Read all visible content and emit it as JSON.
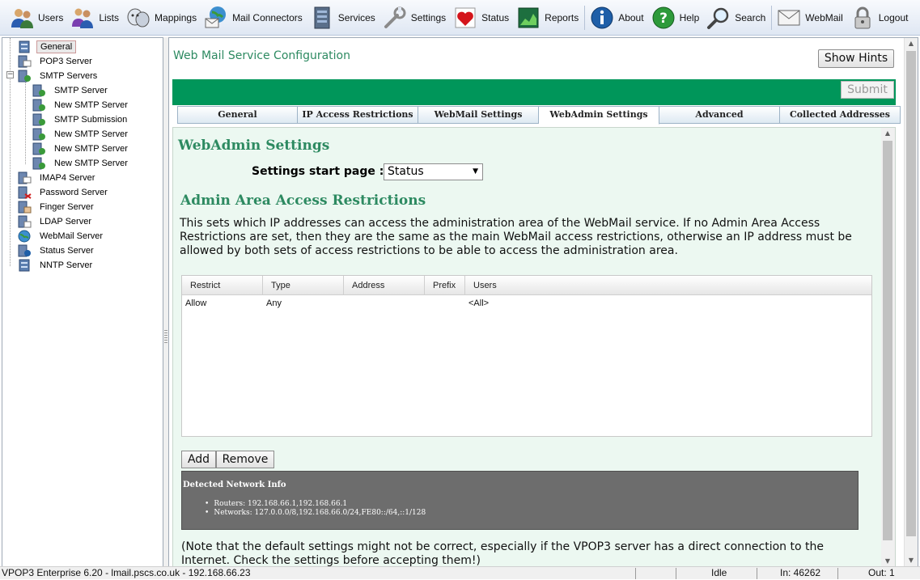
{
  "toolbar": {
    "items": [
      {
        "label": "Users",
        "icon": "users-icon"
      },
      {
        "label": "Lists",
        "icon": "lists-icon"
      },
      {
        "label": "Mappings",
        "icon": "mappings-icon"
      },
      {
        "label": "Mail Connectors",
        "icon": "mail-connectors-icon"
      },
      {
        "label": "Services",
        "icon": "services-icon"
      },
      {
        "label": "Settings",
        "icon": "settings-icon"
      },
      {
        "label": "Status",
        "icon": "status-icon"
      },
      {
        "label": "Reports",
        "icon": "reports-icon"
      },
      {
        "label": "About",
        "icon": "about-icon"
      },
      {
        "label": "Help",
        "icon": "help-icon"
      },
      {
        "label": "Search",
        "icon": "search-icon"
      },
      {
        "label": "WebMail",
        "icon": "webmail-icon"
      },
      {
        "label": "Logout",
        "icon": "logout-icon"
      }
    ]
  },
  "tree": {
    "items": [
      {
        "label": "General",
        "selected": true
      },
      {
        "label": "POP3 Server"
      },
      {
        "label": "SMTP Servers",
        "expanded": true
      },
      {
        "label": "SMTP Server"
      },
      {
        "label": "New SMTP Server"
      },
      {
        "label": "SMTP Submission"
      },
      {
        "label": "New SMTP Server"
      },
      {
        "label": "New SMTP Server"
      },
      {
        "label": "New SMTP Server"
      },
      {
        "label": "IMAP4 Server"
      },
      {
        "label": "Password Server"
      },
      {
        "label": "Finger Server"
      },
      {
        "label": "LDAP Server"
      },
      {
        "label": "WebMail Server"
      },
      {
        "label": "Status Server"
      },
      {
        "label": "NNTP Server"
      }
    ],
    "toggle_symbol": "−"
  },
  "main": {
    "title": "Web Mail Service Configuration",
    "show_hints_label": "Show Hints",
    "submit_label": "Submit",
    "tabs": [
      {
        "label": "General"
      },
      {
        "label": "IP Access Restrictions"
      },
      {
        "label": "WebMail Settings"
      },
      {
        "label": "WebAdmin Settings",
        "active": true
      },
      {
        "label": "Advanced"
      },
      {
        "label": "Collected Addresses"
      }
    ],
    "section_heading": "WebAdmin Settings",
    "settings_start_label": "Settings start page :",
    "settings_start_value": "Status",
    "admin_heading": "Admin Area Access Restrictions",
    "description": "This sets which IP addresses can access the administration area of the WebMail service. If no Admin Area Access Restrictions are set, then they are the same as the main WebMail access restrictions, otherwise an IP address must be allowed by both sets of access restrictions to be able to access the administration area.",
    "grid": {
      "columns": [
        "Restrict",
        "Type",
        "Address",
        "Prefix",
        "Users"
      ],
      "rows": [
        [
          "Allow",
          "Any",
          "",
          "",
          "<All>"
        ]
      ]
    },
    "add_label": "Add",
    "remove_label": "Remove",
    "network_info": {
      "title": "Detected Network Info",
      "routers": "Routers: 192.168.66.1,192.168.66.1",
      "networks": "Networks: 127.0.0.0/8,192.168.66.0/24,FE80::/64,::1/128"
    },
    "note": "(Note that the default settings might not be correct, especially if the VPOP3 server has a direct connection to the Internet. Check the settings before accepting them!)"
  },
  "statusbar": {
    "left": "VPOP3 Enterprise 6.20 - lmail.pscs.co.uk - 192.168.66.23",
    "state": "Idle",
    "in": "In: 46262",
    "out": "Out: 1"
  },
  "colors": {
    "accent_green": "#00965a",
    "heading_green": "#2d8a61",
    "content_bg": "#ecf8f1",
    "network_box": "#6d6d6d"
  }
}
